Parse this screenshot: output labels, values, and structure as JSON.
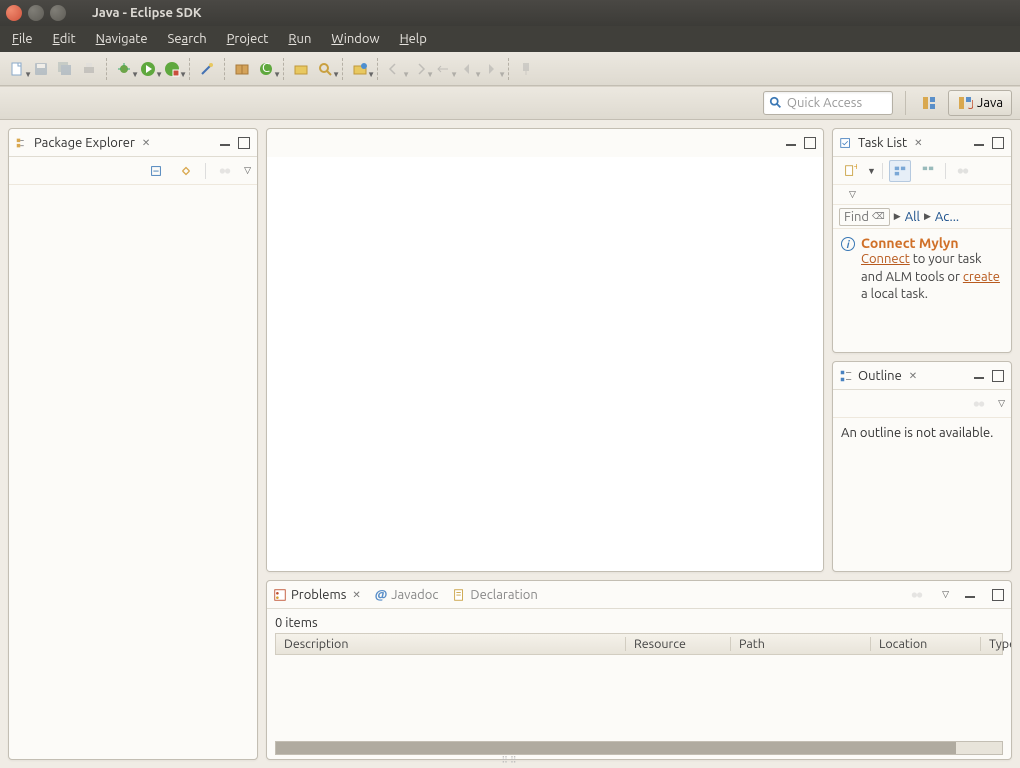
{
  "window": {
    "title": "Java - Eclipse SDK"
  },
  "menu": {
    "file": "File",
    "edit": "Edit",
    "navigate": "Navigate",
    "search": "Search",
    "project": "Project",
    "run": "Run",
    "window": "Window",
    "help": "Help"
  },
  "quickaccess": {
    "placeholder": "Quick Access"
  },
  "perspective": {
    "java": "Java"
  },
  "packageExplorer": {
    "title": "Package Explorer"
  },
  "taskList": {
    "title": "Task List",
    "find": "Find",
    "all": "All",
    "activate": "Ac...",
    "mylynTitle": "Connect Mylyn",
    "connect": "Connect",
    "text1": " to your task and ALM tools or ",
    "create": "create",
    "text2": " a local task."
  },
  "outline": {
    "title": "Outline",
    "empty": "An outline is not available."
  },
  "bottom": {
    "problems": "Problems",
    "javadoc": "Javadoc",
    "declaration": "Declaration",
    "items": "0 items",
    "cols": {
      "description": "Description",
      "resource": "Resource",
      "path": "Path",
      "location": "Location",
      "type": "Type"
    }
  }
}
